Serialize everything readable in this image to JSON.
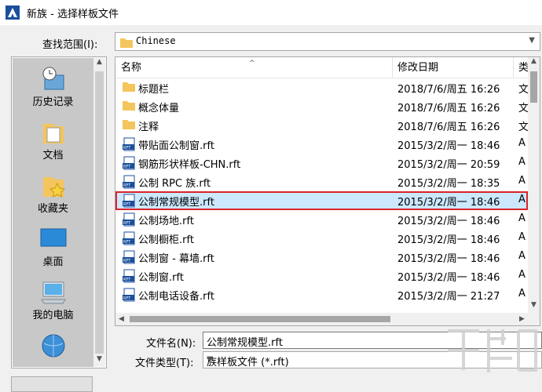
{
  "window": {
    "title": "新族 - 选择样板文件"
  },
  "lookin": {
    "label": "查找范围(I):",
    "value": "Chinese"
  },
  "places": [
    {
      "label": "历史记录",
      "icon": "history-icon"
    },
    {
      "label": "文档",
      "icon": "documents-icon"
    },
    {
      "label": "收藏夹",
      "icon": "favorites-icon"
    },
    {
      "label": "桌面",
      "icon": "desktop-icon"
    },
    {
      "label": "我的电脑",
      "icon": "computer-icon"
    },
    {
      "label": "",
      "icon": "network-icon"
    }
  ],
  "columns": {
    "name": "名称",
    "date": "修改日期",
    "type": "类"
  },
  "files": [
    {
      "name": "标题栏",
      "date": "2018/7/6/周五 16:26",
      "type": "文",
      "kind": "folder"
    },
    {
      "name": "概念体量",
      "date": "2018/7/6/周五 16:26",
      "type": "文",
      "kind": "folder"
    },
    {
      "name": "注释",
      "date": "2018/7/6/周五 16:26",
      "type": "文",
      "kind": "folder"
    },
    {
      "name": "带贴面公制窗.rft",
      "date": "2015/3/2/周一 18:46",
      "type": "A",
      "kind": "rft"
    },
    {
      "name": "钢筋形状样板-CHN.rft",
      "date": "2015/3/2/周一 20:59",
      "type": "A",
      "kind": "rft"
    },
    {
      "name": "公制 RPC 族.rft",
      "date": "2015/3/2/周一 18:35",
      "type": "A",
      "kind": "rft"
    },
    {
      "name": "公制常规模型.rft",
      "date": "2015/3/2/周一 18:46",
      "type": "A",
      "kind": "rft",
      "selected": true
    },
    {
      "name": "公制场地.rft",
      "date": "2015/3/2/周一 18:46",
      "type": "A",
      "kind": "rft"
    },
    {
      "name": "公制橱柜.rft",
      "date": "2015/3/2/周一 18:46",
      "type": "A",
      "kind": "rft"
    },
    {
      "name": "公制窗 - 幕墙.rft",
      "date": "2015/3/2/周一 18:46",
      "type": "A",
      "kind": "rft"
    },
    {
      "name": "公制窗.rft",
      "date": "2015/3/2/周一 18:46",
      "type": "A",
      "kind": "rft"
    },
    {
      "name": "公制电话设备.rft",
      "date": "2015/3/2/周一 21:27",
      "type": "A",
      "kind": "rft"
    }
  ],
  "filename": {
    "label": "文件名(N):",
    "value": "公制常规模型.rft"
  },
  "filetype": {
    "label": "文件类型(T):",
    "value": "族样板文件 (*.rft)"
  },
  "colors": {
    "selection": "#cce8ff",
    "highlight_border": "#d9232a",
    "folder": "#f4c55c"
  }
}
